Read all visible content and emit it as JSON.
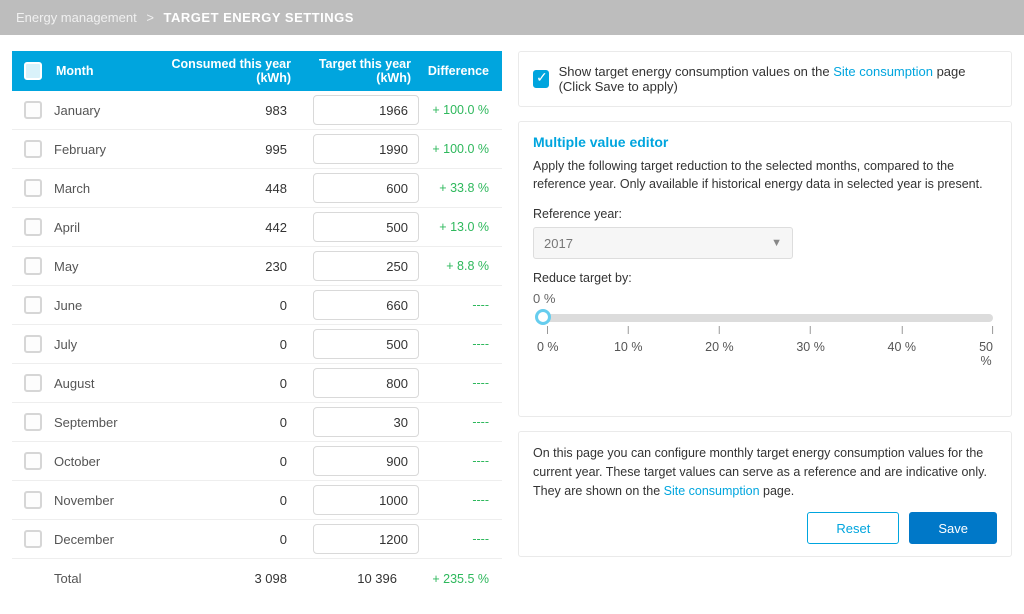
{
  "breadcrumb": {
    "parent": "Energy management",
    "current": "TARGET ENERGY SETTINGS"
  },
  "table": {
    "headers": {
      "month": "Month",
      "consumed": "Consumed this year (kWh)",
      "target": "Target this year (kWh)",
      "diff": "Difference"
    },
    "rows": [
      {
        "month": "January",
        "consumed": "983",
        "target": "1966",
        "diff": "+ 100.0 %"
      },
      {
        "month": "February",
        "consumed": "995",
        "target": "1990",
        "diff": "+ 100.0 %"
      },
      {
        "month": "March",
        "consumed": "448",
        "target": "600",
        "diff": "+ 33.8 %"
      },
      {
        "month": "April",
        "consumed": "442",
        "target": "500",
        "diff": "+ 13.0 %"
      },
      {
        "month": "May",
        "consumed": "230",
        "target": "250",
        "diff": "+ 8.8 %"
      },
      {
        "month": "June",
        "consumed": "0",
        "target": "660",
        "diff": "----"
      },
      {
        "month": "July",
        "consumed": "0",
        "target": "500",
        "diff": "----"
      },
      {
        "month": "August",
        "consumed": "0",
        "target": "800",
        "diff": "----"
      },
      {
        "month": "September",
        "consumed": "0",
        "target": "30",
        "diff": "----"
      },
      {
        "month": "October",
        "consumed": "0",
        "target": "900",
        "diff": "----"
      },
      {
        "month": "November",
        "consumed": "0",
        "target": "1000",
        "diff": "----"
      },
      {
        "month": "December",
        "consumed": "0",
        "target": "1200",
        "diff": "----"
      }
    ],
    "total": {
      "label": "Total",
      "consumed": "3 098",
      "target": "10 396",
      "diff": "+ 235.5 %"
    }
  },
  "showTarget": {
    "pre": "Show target energy consumption values on the ",
    "link": "Site consumption",
    "post": " page (Click Save to apply)"
  },
  "mve": {
    "title": "Multiple value editor",
    "desc": "Apply the following target reduction to the selected months, compared to the reference year. Only available if historical energy data in selected year is present.",
    "refLabel": "Reference year:",
    "refValue": "2017",
    "reduceLabel": "Reduce target by:",
    "reduceValue": "0 %",
    "ticks": [
      "0 %",
      "10 %",
      "20 %",
      "30 %",
      "40 %",
      "50 %"
    ]
  },
  "info": {
    "pre": "On this page you can configure monthly target energy consumption values for the current year. These target values can serve as a reference and are indicative only. They are shown on the ",
    "link": "Site consumption",
    "post": " page."
  },
  "buttons": {
    "reset": "Reset",
    "save": "Save"
  }
}
